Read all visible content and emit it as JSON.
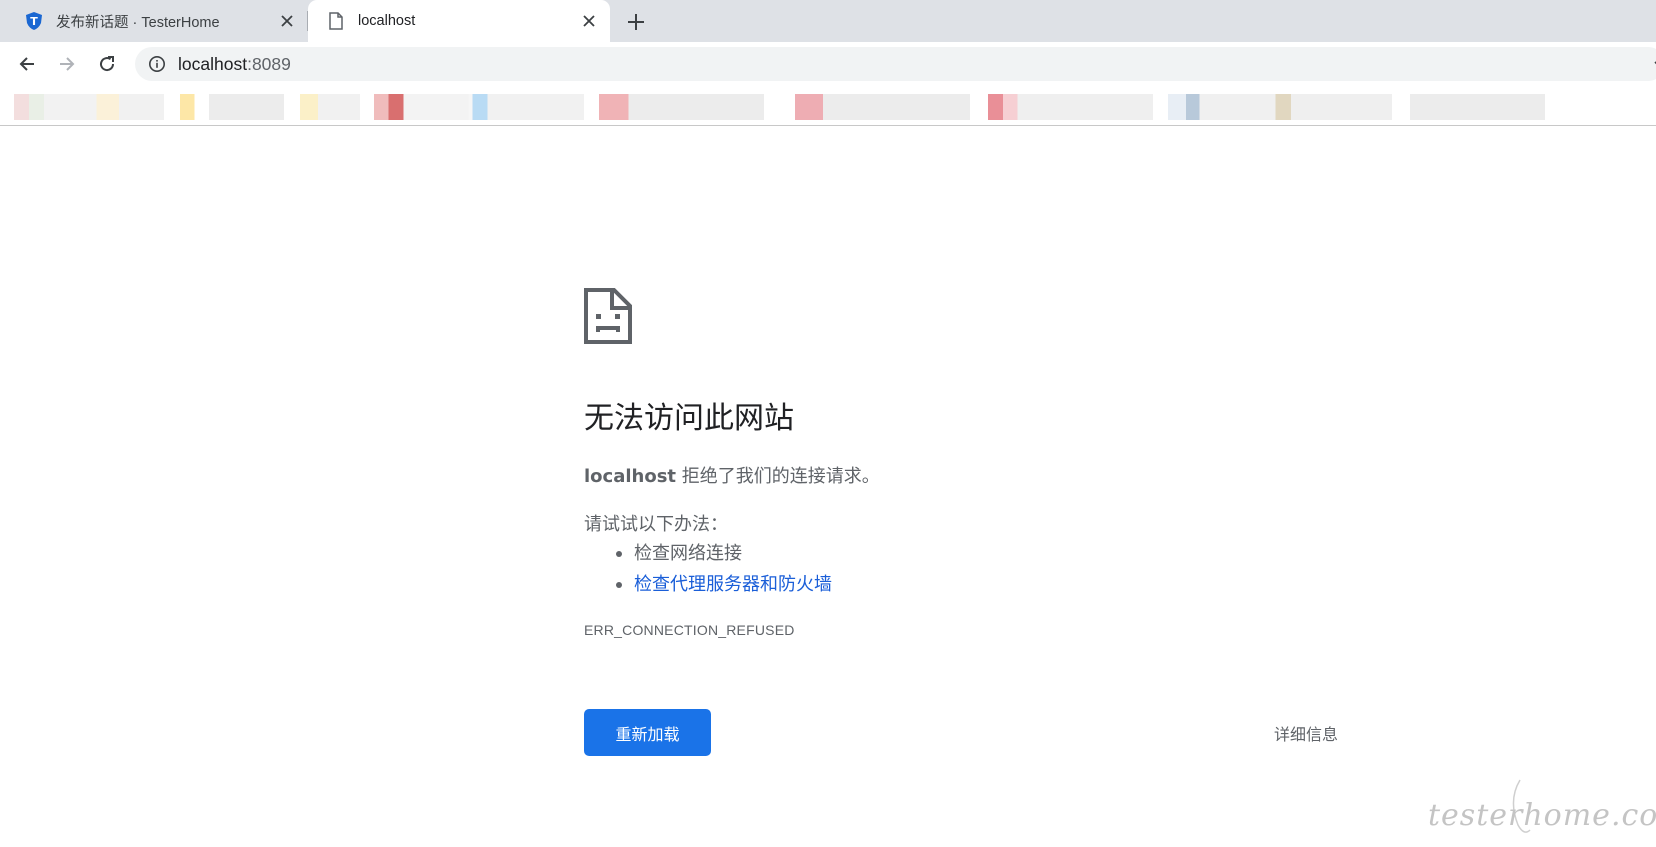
{
  "tabs": [
    {
      "title": "发布新话题 · TesterHome",
      "favicon": "shield-T-icon",
      "favicon_letter": "T",
      "active": false
    },
    {
      "title": "localhost",
      "favicon": "document-icon",
      "active": true
    }
  ],
  "toolbar": {
    "url_host": "localhost",
    "url_port": ":8089"
  },
  "error": {
    "title": "无法访问此网站",
    "host": "localhost",
    "message": " 拒绝了我们的连接请求。",
    "suggestions_title": "请试试以下办法：",
    "suggestions": [
      {
        "text": "检查网络连接",
        "link": false
      },
      {
        "text": "检查代理服务器和防火墙",
        "link": true
      }
    ],
    "code": "ERR_CONNECTION_REFUSED",
    "reload_label": "重新加载",
    "details_label": "详细信息"
  },
  "watermark": "testerhome.com",
  "colors": {
    "tabstrip": "#dee1e6",
    "omnibox": "#f1f3f4",
    "primary_button": "#1a73e8",
    "link": "#1a5ed8",
    "secondary_text": "#5f6368"
  }
}
